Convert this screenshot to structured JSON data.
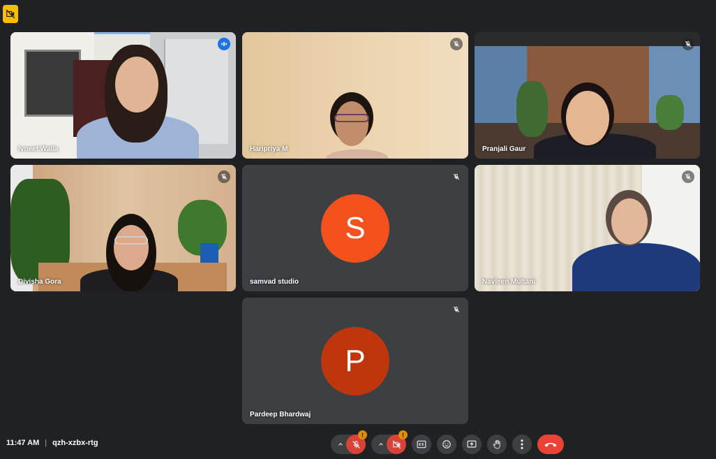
{
  "meeting": {
    "time": "11:47 AM",
    "code": "qzh-xzbx-rtg"
  },
  "participants": [
    {
      "name": "Ivneet Walia",
      "video": true,
      "speaking": true
    },
    {
      "name": "Haripriya M",
      "video": true,
      "muted": true
    },
    {
      "name": "Pranjali Gaur",
      "video": true,
      "muted": true
    },
    {
      "name": "Divisha Gora",
      "video": true,
      "muted": true
    },
    {
      "name": "samvad studio",
      "video": false,
      "muted": true,
      "initial": "S",
      "avatar_color": "#f4511e"
    },
    {
      "name": "Navleen Multani",
      "video": true,
      "muted": true
    },
    {
      "name": "Pardeep Bhardwaj",
      "video": false,
      "muted": true,
      "initial": "P",
      "avatar_color": "#c0360c"
    }
  ],
  "controls": {
    "mic_warning": "!",
    "camera_warning": "!",
    "icons": [
      "chevron-up-icon",
      "mic-off-icon",
      "camera-off-icon",
      "captions-icon",
      "emoji-icon",
      "present-icon",
      "raise-hand-icon",
      "more-options-icon",
      "end-call-icon"
    ]
  },
  "colors": {
    "background": "#202124",
    "tile": "#3c4043",
    "active_border": "#8ab4f8",
    "danger": "#ea4335",
    "warning": "#f29900",
    "badge": "#fbbc04"
  }
}
